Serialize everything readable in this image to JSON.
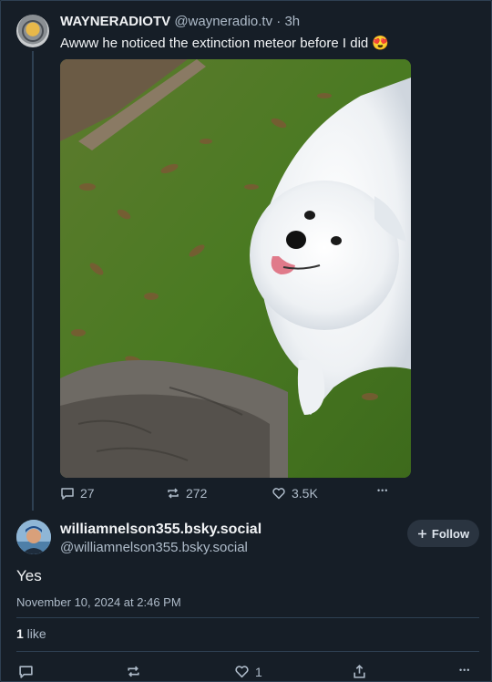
{
  "post": {
    "display_name": "WAYNERADIOTV",
    "handle": "@wayneradio.tv",
    "separator": " · ",
    "time": "3h",
    "text": "Awww he noticed the extinction meteor before I did 😍",
    "image_content": "white fluffy dog on grass with fallen leaves",
    "replies": "27",
    "reposts": "272",
    "likes": "3.5K",
    "more": "•••"
  },
  "reply": {
    "display_name": "williamnelson355.bsky.social",
    "handle": "@williamnelson355.bsky.social",
    "follow_label": "Follow",
    "text": "Yes",
    "date": "November 10, 2024 at 2:46 PM",
    "like_count": "1",
    "like_word": " like",
    "action_like_count": "1",
    "more": "•••"
  },
  "colors": {
    "background": "#161e27",
    "border": "#2e4052",
    "muted_text": "#aebbc9",
    "primary_text": "#f1f3f5"
  }
}
